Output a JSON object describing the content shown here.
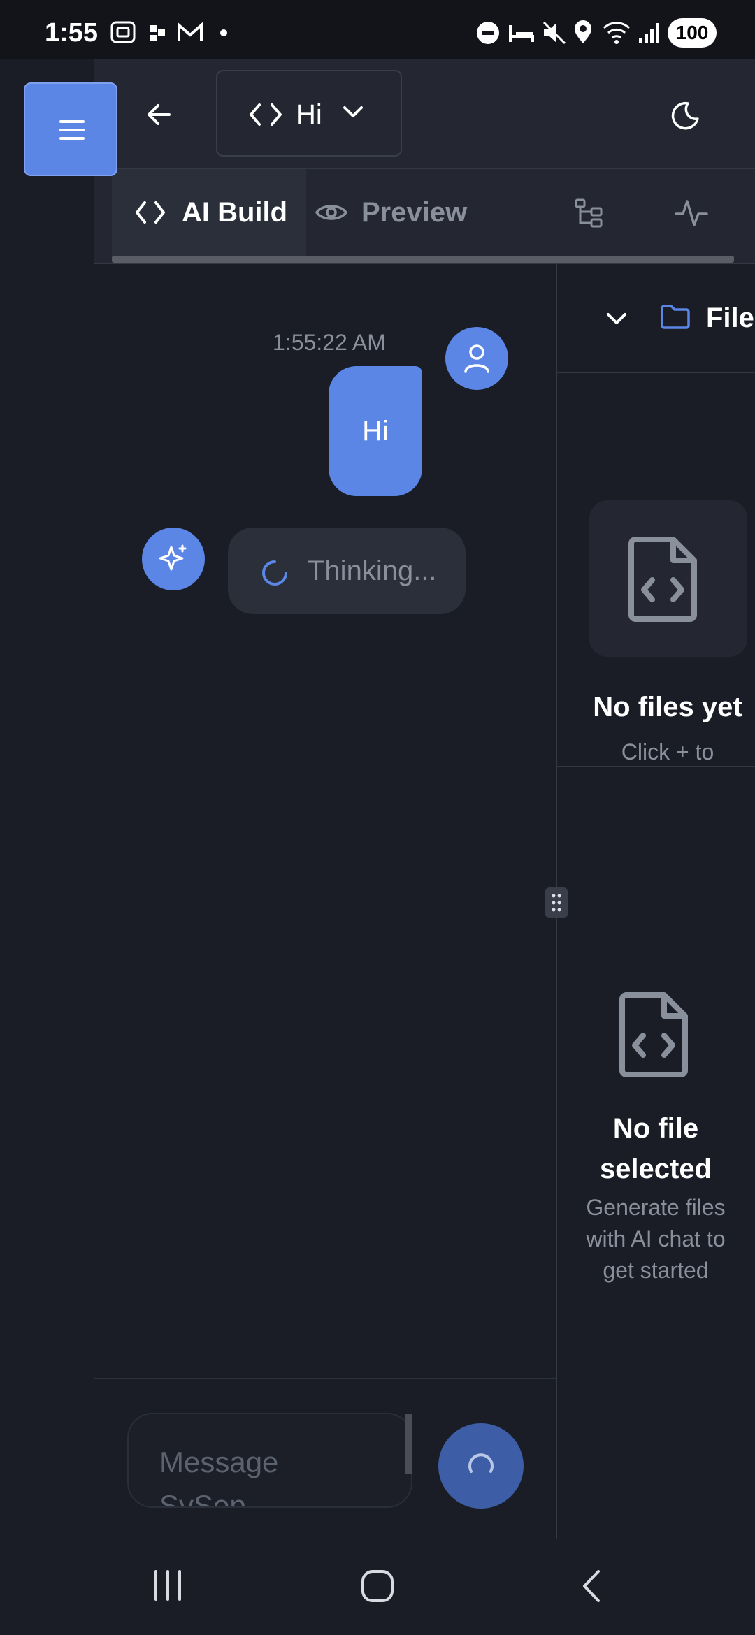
{
  "status_bar": {
    "time": "1:55",
    "battery": "100",
    "icons": [
      "screenshot-icon",
      "app-icon",
      "gmail-icon",
      "dot-icon",
      "do-not-disturb-icon",
      "sleep-icon",
      "mute-icon",
      "location-icon",
      "wifi-icon",
      "signal-icon"
    ]
  },
  "header": {
    "project_title": "Hi",
    "menu_icon": "menu-icon",
    "back_icon": "back-arrow-icon",
    "theme_icon": "moon-icon"
  },
  "tabs": [
    {
      "label": "AI Build",
      "icon": "code-icon",
      "active": true
    },
    {
      "label": "Preview",
      "icon": "eye-icon",
      "active": false
    },
    {
      "label": "",
      "icon": "tree-icon",
      "active": false
    },
    {
      "label": "",
      "icon": "activity-icon",
      "active": false
    }
  ],
  "chat": {
    "messages": [
      {
        "role": "user",
        "time": "1:55:22 AM",
        "text": "Hi"
      },
      {
        "role": "assistant",
        "text": "Thinking..."
      }
    ],
    "input_placeholder": "Message SySop",
    "accent": "#5b86e5"
  },
  "files_panel": {
    "title": "Files",
    "empty_title": "No files yet",
    "empty_hint": "Click + to",
    "editor_empty_title": "No file selected",
    "editor_empty_sub": "Generate files with AI chat to get started"
  }
}
